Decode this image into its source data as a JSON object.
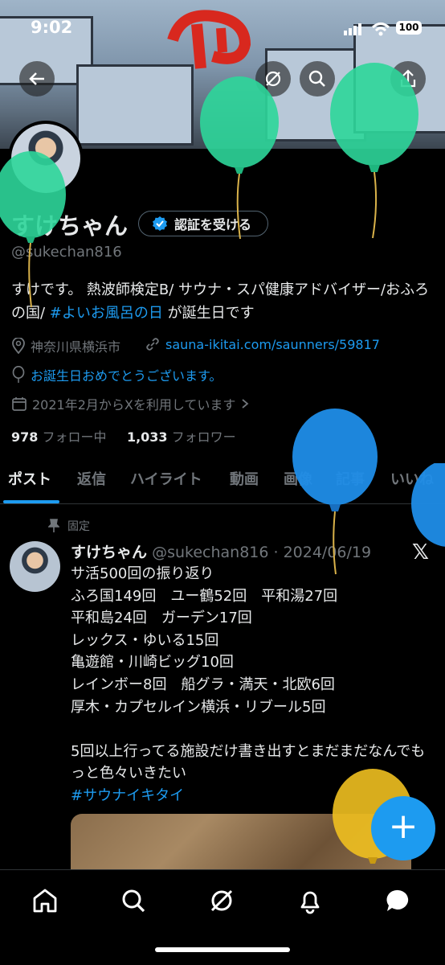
{
  "status_bar": {
    "time": "9:02",
    "battery": "100"
  },
  "profile": {
    "name": "すけちゃん",
    "verify_button": "認証を受ける",
    "handle": "@sukechan816",
    "bio_text": "すけです。 熱波師検定B/ サウナ・スパ健康アドバイザー/おふろの国/ ",
    "bio_hashtag": "#よいお風呂の日",
    "bio_suffix": " が誕生日です",
    "location": "神奈川県横浜市",
    "website": "sauna-ikitai.com/saunners/59817",
    "birthday": "お誕生日おめでとうございます。",
    "joined": "2021年2月からXを利用しています",
    "following_count": "978",
    "following_label": "フォロー中",
    "followers_count": "1,033",
    "followers_label": "フォロワー"
  },
  "tabs": [
    "ポスト",
    "返信",
    "ハイライト",
    "動画",
    "画像",
    "記事",
    "いいね"
  ],
  "pinned_post": {
    "pinned_label": "固定",
    "author": "すけちゃん",
    "handle_date": "@sukechan816 · 2024/06/19",
    "body": "サ活500回の振り返り\nふろ国149回　ユー鶴52回　平和湯27回\n平和島24回　ガーデン17回\nレックス・ゆいる15回\n亀遊館・川崎ビッグ10回\nレインボー8回　船グラ・満天・北欧6回\n厚木・カプセルイン横浜・リブール5回\n\n5回以上行ってる施設だけ書き出すとまだまだなんでもっと色々いきたい",
    "hashtag": "#サウナイキタイ"
  },
  "colors": {
    "accent": "#1d9bf0",
    "balloon_green": "#2ed69a",
    "balloon_blue": "#1f8de8",
    "balloon_yellow": "#f0c020"
  },
  "icons": [
    "back-arrow-icon",
    "grok-icon",
    "search-icon",
    "share-icon",
    "verified-badge-icon",
    "location-icon",
    "link-icon",
    "balloon-icon",
    "calendar-icon",
    "chevron-right-icon",
    "pin-icon",
    "x-logo-icon",
    "plus-icon",
    "home-icon",
    "explore-icon",
    "grok-nav-icon",
    "notifications-icon",
    "messages-icon"
  ]
}
